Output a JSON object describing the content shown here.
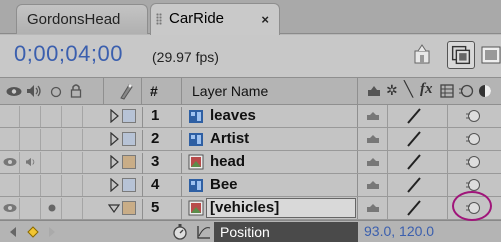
{
  "tabs": [
    {
      "label": "GordonsHead",
      "active": false
    },
    {
      "label": "CarRide",
      "active": true
    }
  ],
  "tab_close_glyph": "×",
  "timecode": "0;00;04;00",
  "fps": "(29.97 fps)",
  "header": {
    "number": "#",
    "layer_name": "Layer Name",
    "switch_icons": [
      "eye-icon",
      "speaker-icon",
      "solo-icon",
      "lock-icon"
    ],
    "right_icons": [
      "shy-icon",
      "collapse-icon",
      "quality-icon",
      "fx-icon",
      "frame-blend-icon",
      "motion-blur-icon",
      "adjustment-icon"
    ]
  },
  "layers": [
    {
      "number": "1",
      "name": "leaves",
      "type": "composition",
      "eye": false,
      "audio": false,
      "twirl": "closed",
      "label_color": "#b7c3d6",
      "motion_blur": true
    },
    {
      "number": "2",
      "name": "Artist",
      "type": "composition",
      "eye": false,
      "audio": false,
      "twirl": "closed",
      "label_color": "#b7c3d6",
      "motion_blur": true
    },
    {
      "number": "3",
      "name": "head",
      "type": "footage",
      "eye": true,
      "audio": true,
      "twirl": "closed",
      "label_color": "#c9ad87",
      "motion_blur": true
    },
    {
      "number": "4",
      "name": "Bee",
      "type": "composition",
      "eye": false,
      "audio": false,
      "twirl": "closed",
      "label_color": "#b7c3d6",
      "motion_blur": true
    },
    {
      "number": "5",
      "name": "[vehicles]",
      "type": "footage",
      "eye": true,
      "audio": false,
      "solo": true,
      "twirl": "open",
      "label_color": "#c9ad87",
      "motion_blur": true,
      "editing": true
    }
  ],
  "property": {
    "name": "Position",
    "value": "93.0, 120.0"
  },
  "colors": {
    "timecode": "#3b5fae",
    "highlight": "#a0157a"
  }
}
